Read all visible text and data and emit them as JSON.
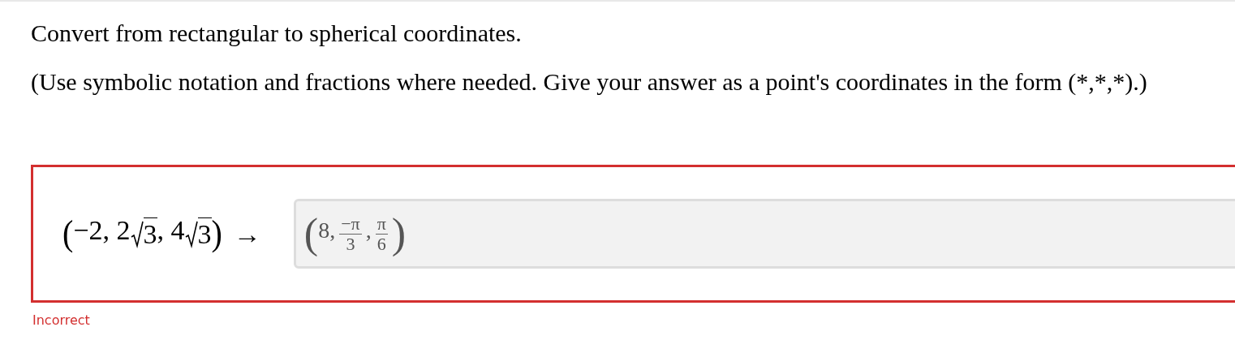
{
  "question": {
    "title": "Convert from rectangular to spherical coordinates.",
    "instructions": "(Use symbolic notation and fractions where needed. Give your answer as a point's coordinates in the form (*,*,*).)"
  },
  "problem": {
    "open": "(",
    "close": ")",
    "arrow": "→",
    "parts": [
      {
        "kind": "text",
        "text": "−2, 2"
      },
      {
        "kind": "sqrt",
        "text": "3"
      },
      {
        "kind": "text",
        "text": ", 4"
      },
      {
        "kind": "sqrt",
        "text": "3"
      }
    ]
  },
  "answer": {
    "open": "(",
    "close": ")",
    "parts": [
      {
        "kind": "text",
        "text": "8,"
      },
      {
        "kind": "frac",
        "num": "−π",
        "den": "3"
      },
      {
        "kind": "text",
        "text": ","
      },
      {
        "kind": "frac",
        "num": "π",
        "den": "6"
      }
    ]
  },
  "status": {
    "text": "Incorrect",
    "correct": false
  }
}
